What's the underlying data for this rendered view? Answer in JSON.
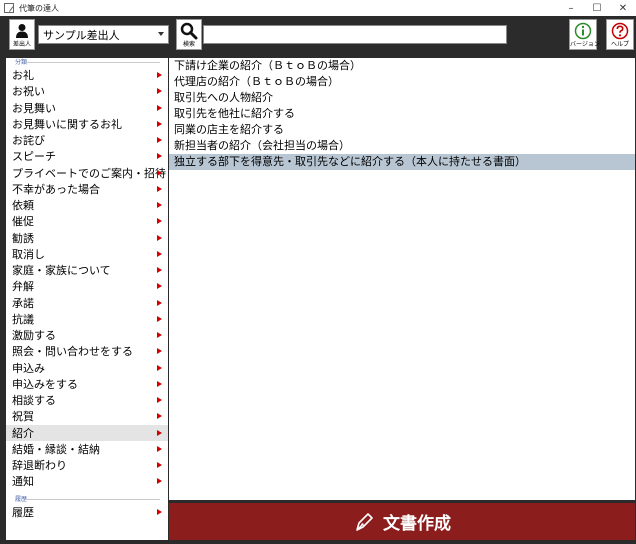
{
  "window": {
    "title": "代筆の達人",
    "minimize": "–",
    "maximize": "☐",
    "close": "✕"
  },
  "toolbar": {
    "sender_caption": "差出人",
    "sender_value": "サンプル差出人",
    "search_caption": "検索",
    "search_value": "",
    "version_caption": "バージョン",
    "help_caption": "ヘルプ"
  },
  "sidebar": {
    "category_label": "分類",
    "history_label": "履歴",
    "items": [
      {
        "label": "お礼"
      },
      {
        "label": "お祝い"
      },
      {
        "label": "お見舞い"
      },
      {
        "label": "お見舞いに関するお礼"
      },
      {
        "label": "お詫び"
      },
      {
        "label": "スピーチ"
      },
      {
        "label": "プライベートでのご案内・招待"
      },
      {
        "label": "不幸があった場合"
      },
      {
        "label": "依頼"
      },
      {
        "label": "催促"
      },
      {
        "label": "勧誘"
      },
      {
        "label": "取消し"
      },
      {
        "label": "家庭・家族について"
      },
      {
        "label": "弁解"
      },
      {
        "label": "承諾"
      },
      {
        "label": "抗議"
      },
      {
        "label": "激励する"
      },
      {
        "label": "照会・問い合わせをする"
      },
      {
        "label": "申込み"
      },
      {
        "label": "申込みをする"
      },
      {
        "label": "相談する"
      },
      {
        "label": "祝賀"
      },
      {
        "label": "紹介",
        "selected": true
      },
      {
        "label": "結婚・縁談・結納"
      },
      {
        "label": "辞退断わり"
      },
      {
        "label": "通知"
      }
    ],
    "history_items": [
      {
        "label": "履歴"
      }
    ]
  },
  "documents": [
    {
      "label": "下請け企業の紹介（ＢｔｏＢの場合）"
    },
    {
      "label": "代理店の紹介（ＢｔｏＢの場合）"
    },
    {
      "label": "取引先への人物紹介"
    },
    {
      "label": "取引先を他社に紹介する"
    },
    {
      "label": "同業の店主を紹介する"
    },
    {
      "label": "新担当者の紹介（会社担当の場合）"
    },
    {
      "label": "独立する部下を得意先・取引先などに紹介する（本人に持たせる書面）",
      "selected": true
    }
  ],
  "create_button": {
    "label": "文書作成"
  },
  "colors": {
    "toolbar_bg": "#2b2b2b",
    "create_bg": "#8b1d1d",
    "selected_doc": "#b8c6d3",
    "arrow": "#d40000",
    "version_icon": "#2e8b2e",
    "help_icon": "#c00000"
  }
}
